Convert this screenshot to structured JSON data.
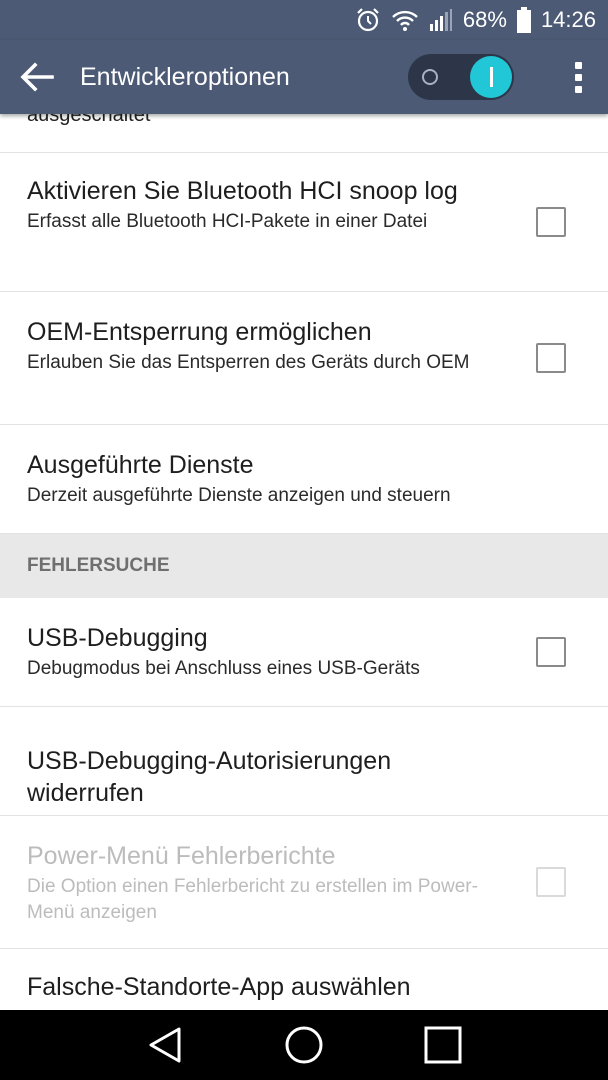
{
  "status_bar": {
    "battery": "68%",
    "time": "14:26",
    "icons": [
      "alarm-icon",
      "wifi-icon",
      "signal-icon",
      "battery-icon"
    ]
  },
  "app_bar": {
    "title": "Entwickleroptionen",
    "back_icon": "back-arrow-icon",
    "master_switch": "on",
    "overflow_icon": "overflow-menu-icon"
  },
  "partial_item": "ausgeschaltet",
  "items_top": [
    {
      "title": "Aktivieren Sie Bluetooth HCI snoop log",
      "subtitle": "Erfasst alle Bluetooth HCI-Pakete in einer Datei",
      "checked": false
    },
    {
      "title": "OEM-Entsperrung ermöglichen",
      "subtitle": "Erlauben Sie das Entsperren des Geräts durch OEM",
      "checked": false
    },
    {
      "title": "Ausgeführte Dienste",
      "subtitle": "Derzeit ausgeführte Dienste anzeigen und steuern"
    }
  ],
  "section_header": "FEHLERSUCHE",
  "items_debug": [
    {
      "title": "USB-Debugging",
      "subtitle": "Debugmodus bei Anschluss eines USB-Geräts",
      "checked": false
    },
    {
      "title": "USB-Debugging-Autorisierungen widerrufen"
    },
    {
      "title": "Power-Menü Fehlerberichte",
      "subtitle": "Die Option einen Fehlerbericht zu erstellen im Power-Menü anzeigen",
      "checked": false,
      "disabled": true
    },
    {
      "title": "Falsche-Standorte-App auswählen"
    }
  ],
  "nav_bar": {
    "icons": [
      "back-triangle-icon",
      "home-circle-icon",
      "recents-square-icon"
    ]
  },
  "colors": {
    "app_bar": "#4c5a75",
    "accent": "#21c7d6",
    "section_bg": "#e8e8e8"
  }
}
